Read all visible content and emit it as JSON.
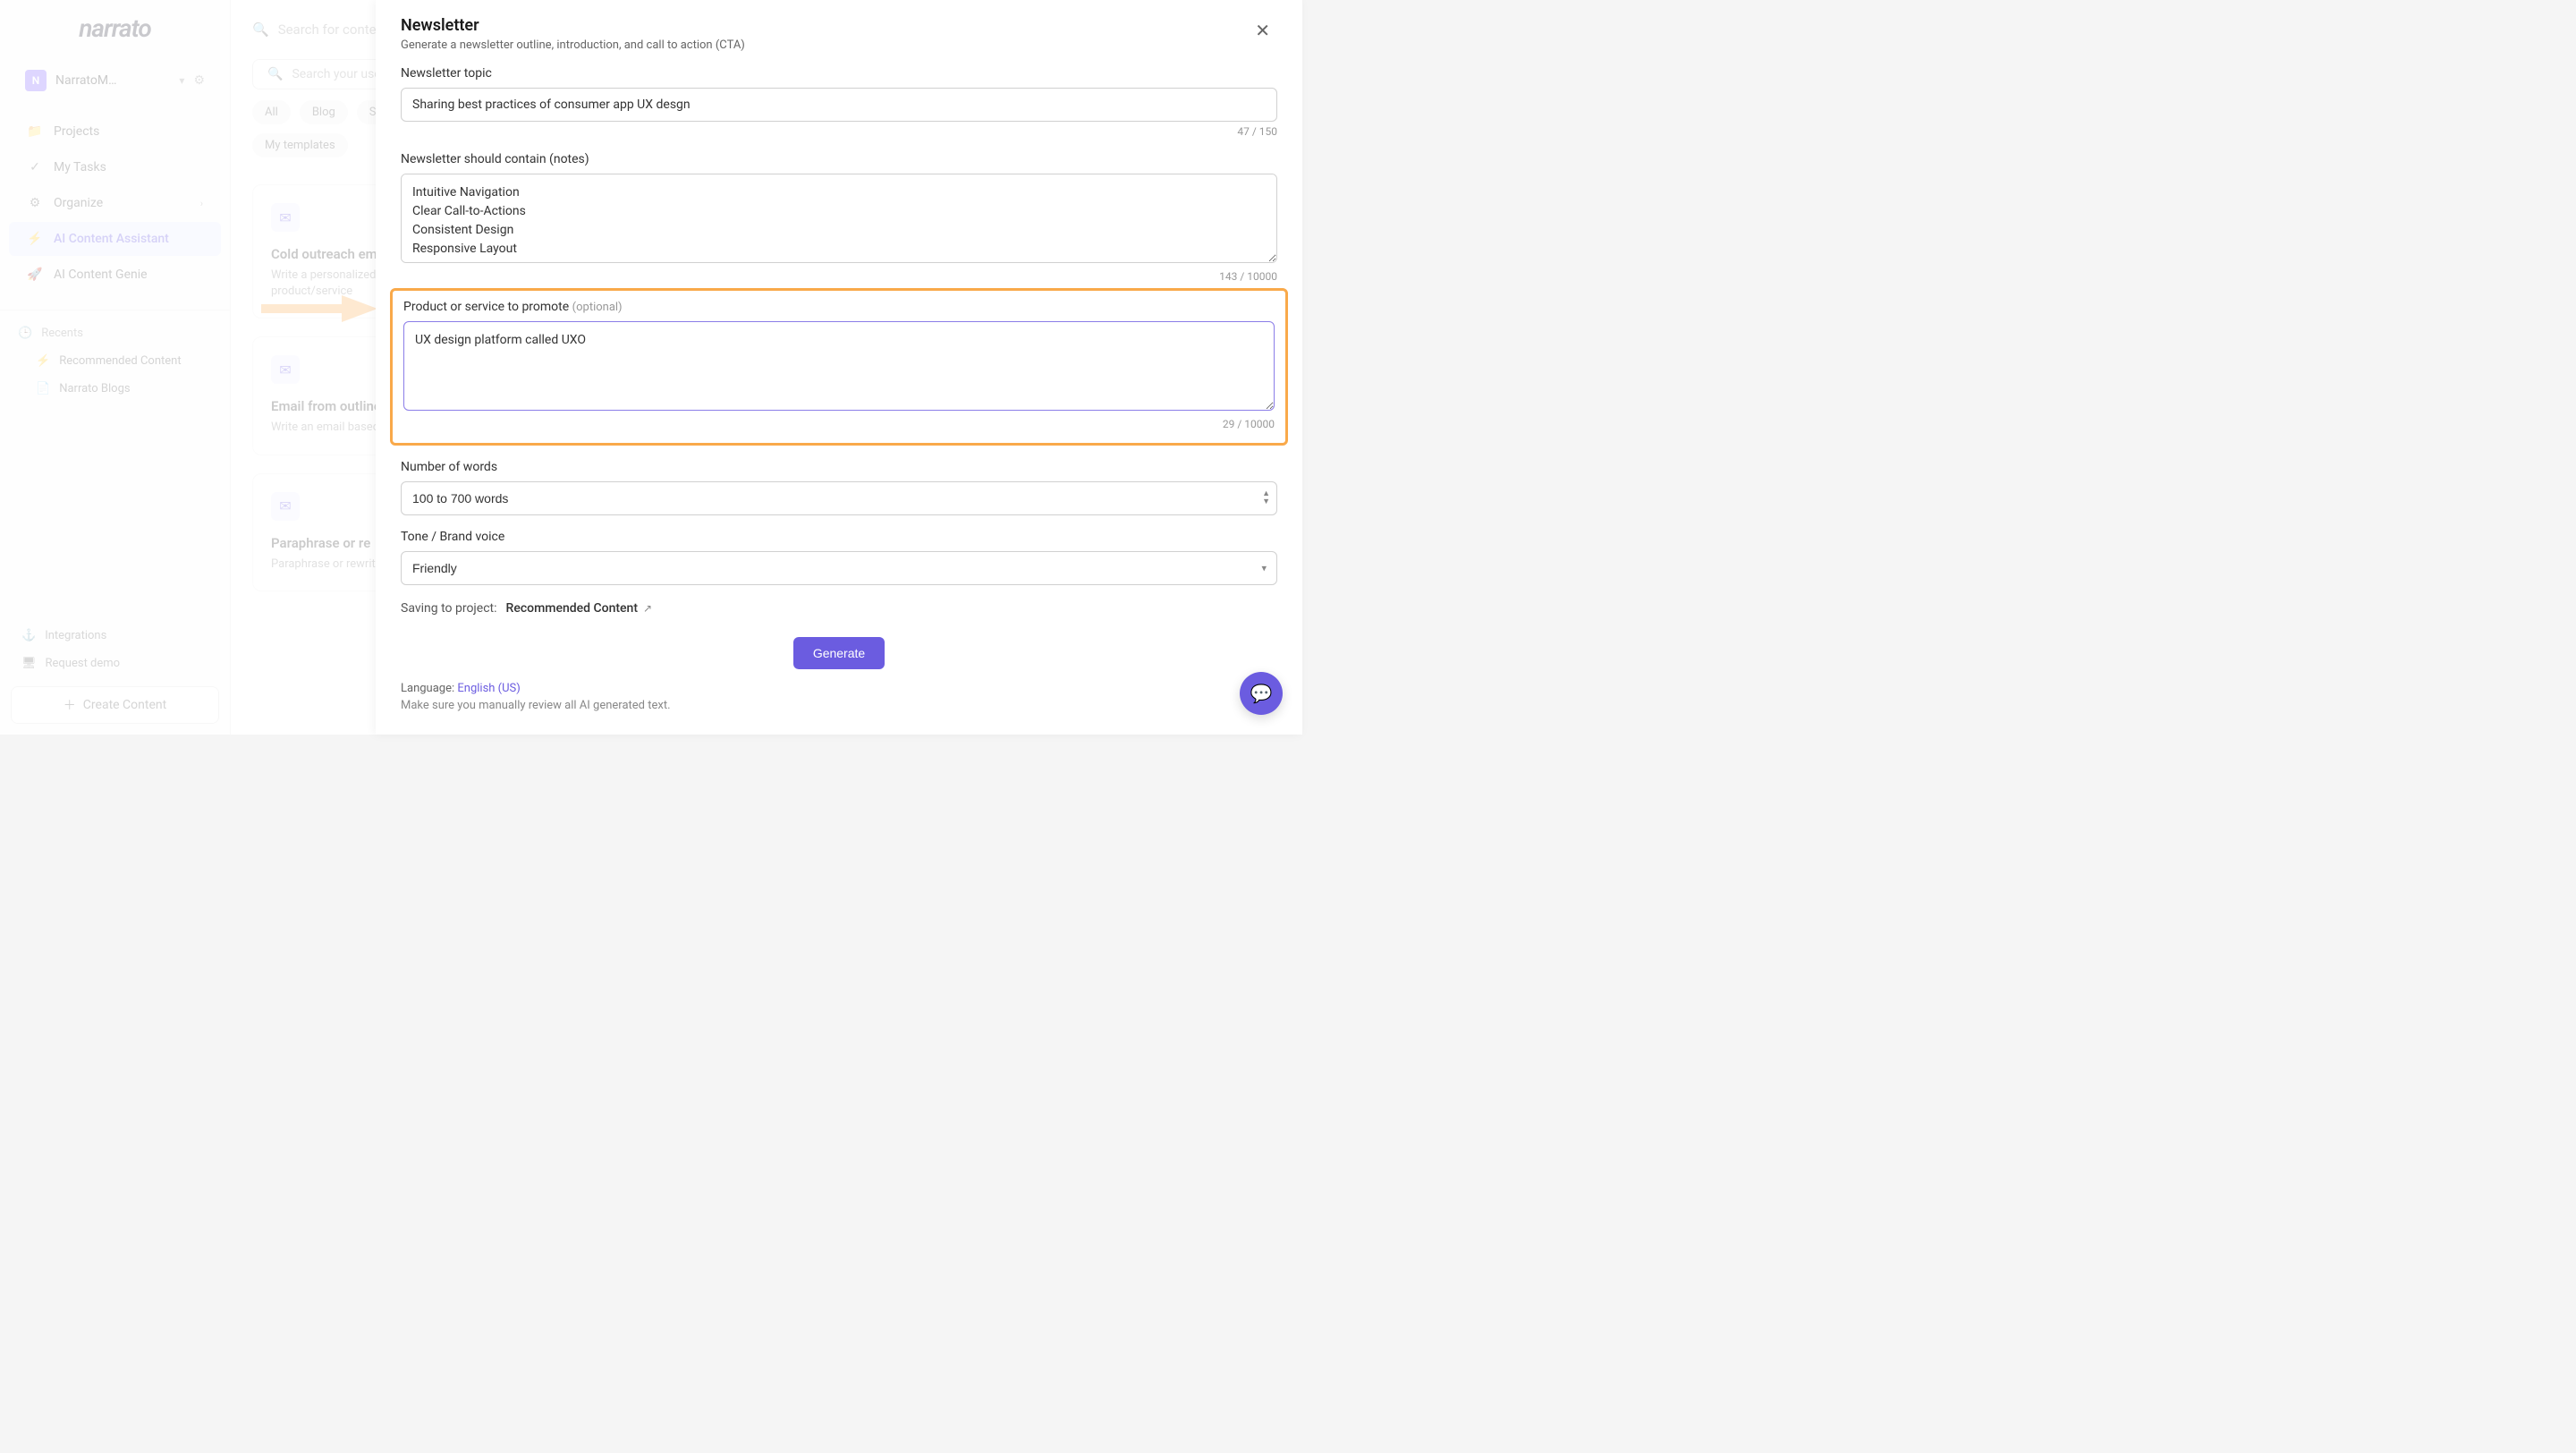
{
  "logo": "narrato",
  "workspace": {
    "badge": "N",
    "name": "NarratoM…"
  },
  "nav": {
    "projects": "Projects",
    "mytasks": "My Tasks",
    "organize": "Organize",
    "assistant": "AI Content Assistant",
    "genie": "AI Content Genie"
  },
  "recents": {
    "header": "Recents",
    "items": [
      "Recommended Content",
      "Narrato Blogs"
    ]
  },
  "footer": {
    "integrations": "Integrations",
    "request_demo": "Request demo",
    "create_content": "Create Content"
  },
  "main": {
    "search_placeholder": "Search for content",
    "search2_placeholder": "Search your use",
    "filters": [
      "All",
      "Blog",
      "S"
    ],
    "mytemplates": "My templates"
  },
  "cards": [
    {
      "title": "Cold outreach email",
      "desc": "Write a personalized email to pitch a specific product/service"
    },
    {
      "title": "Email from outline",
      "desc": "Write an email based on an outline"
    },
    {
      "title": "Paraphrase or re",
      "desc": "Paraphrase or rewrite"
    }
  ],
  "modal": {
    "title": "Newsletter",
    "subtitle": "Generate a newsletter outline, introduction, and call to action (CTA)",
    "topic_label": "Newsletter topic",
    "topic_value": "Sharing best practices of consumer app UX desgn",
    "topic_count": "47 / 150",
    "notes_label": "Newsletter should contain (notes)",
    "notes_value": "Intuitive Navigation\nClear Call-to-Actions\nConsistent Design\nResponsive Layout",
    "notes_count": "143 / 10000",
    "product_label": "Product or service to promote",
    "product_optional": "(optional)",
    "product_value": "UX design platform called UXO",
    "product_count": "29 / 10000",
    "words_label": "Number of words",
    "words_value": "100 to 700 words",
    "tone_label": "Tone / Brand voice",
    "tone_value": "Friendly",
    "saving_label": "Saving to project:",
    "saving_project": "Recommended Content",
    "generate_button": "Generate",
    "language_label": "Language:",
    "language_value": "English (US)",
    "review_text": "Make sure you manually review all AI generated text."
  }
}
